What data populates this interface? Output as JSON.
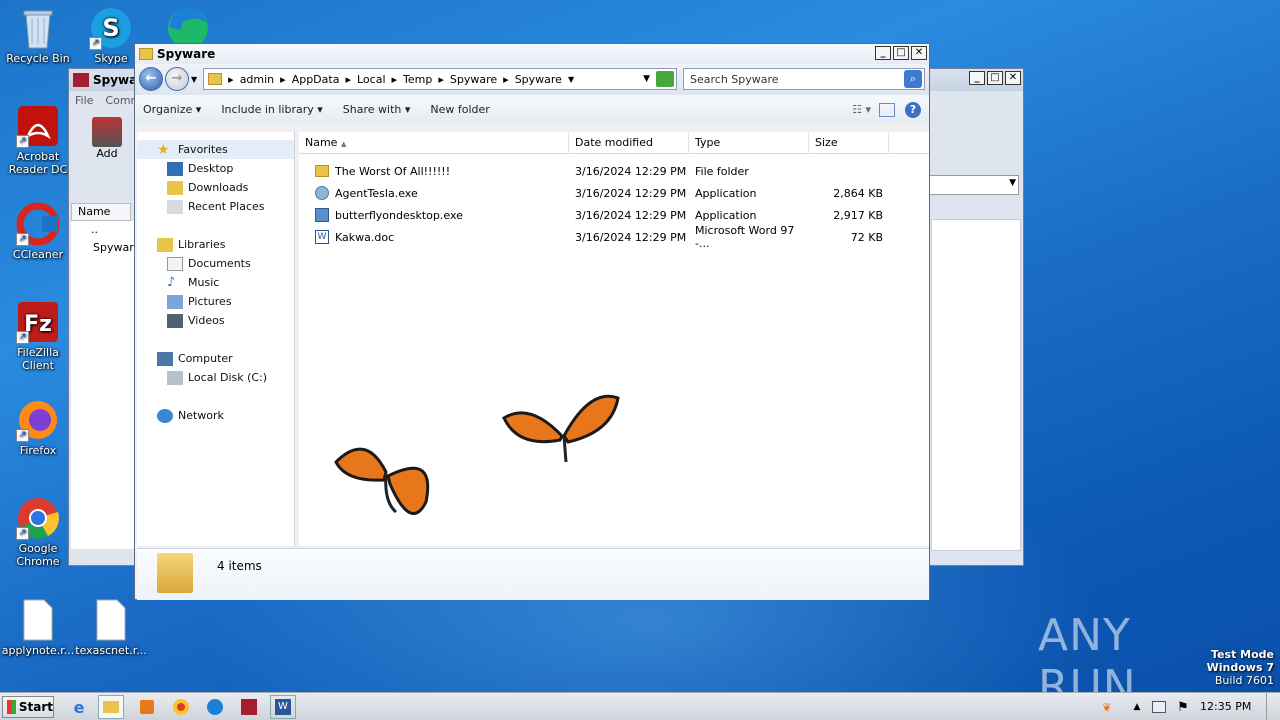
{
  "desktop": {
    "icons": [
      {
        "label": "Recycle Bin"
      },
      {
        "label": "Skype"
      },
      {
        "label": "Acrobat Reader DC"
      },
      {
        "label": "CCleaner"
      },
      {
        "label": "FileZilla Client"
      },
      {
        "label": "Firefox"
      },
      {
        "label": "Google Chrome"
      },
      {
        "label": "applynote.r..."
      },
      {
        "label": "texascnet.r..."
      }
    ],
    "watermark": {
      "brand": "ANY RUN",
      "mode": "Test Mode",
      "os": "Windows 7",
      "build": "Build 7601"
    }
  },
  "bg_window": {
    "title": "Spyware",
    "menu": [
      "File",
      "Comm"
    ],
    "add_label": "Add",
    "col_name": "Name",
    "items": [
      "..",
      "Spyware"
    ]
  },
  "explorer": {
    "title": "Spyware",
    "breadcrumb": [
      "admin",
      "AppData",
      "Local",
      "Temp",
      "Spyware",
      "Spyware"
    ],
    "search_placeholder": "Search Spyware",
    "toolbar": {
      "organize": "Organize",
      "include": "Include in library",
      "share": "Share with",
      "newfolder": "New folder"
    },
    "nav": {
      "favorites": "Favorites",
      "desktop": "Desktop",
      "downloads": "Downloads",
      "recent": "Recent Places",
      "libraries": "Libraries",
      "documents": "Documents",
      "music": "Music",
      "pictures": "Pictures",
      "videos": "Videos",
      "computer": "Computer",
      "localdisk": "Local Disk (C:)",
      "network": "Network"
    },
    "columns": {
      "name": "Name",
      "date": "Date modified",
      "type": "Type",
      "size": "Size"
    },
    "files": [
      {
        "name": "The Worst Of All!!!!!!",
        "date": "3/16/2024 12:29 PM",
        "type": "File folder",
        "size": ""
      },
      {
        "name": "AgentTesla.exe",
        "date": "3/16/2024 12:29 PM",
        "type": "Application",
        "size": "2,864 KB"
      },
      {
        "name": "butterflyondesktop.exe",
        "date": "3/16/2024 12:29 PM",
        "type": "Application",
        "size": "2,917 KB"
      },
      {
        "name": "Kakwa.doc",
        "date": "3/16/2024 12:29 PM",
        "type": "Microsoft Word 97 -...",
        "size": "72 KB"
      }
    ],
    "status": "4 items"
  },
  "taskbar": {
    "start": "Start",
    "clock": "12:35 PM"
  },
  "colors": {
    "butterfly": "#e8761a",
    "accent": "#1f5fb8"
  }
}
